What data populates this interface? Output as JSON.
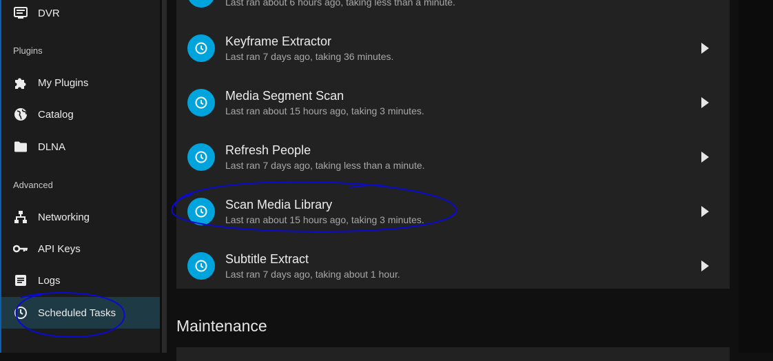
{
  "sidebar": {
    "items_top": [
      {
        "label": "DVR",
        "icon": "tv-icon"
      }
    ],
    "plugins_header": "Plugins",
    "plugins": [
      {
        "label": "My Plugins",
        "icon": "puzzle-icon"
      },
      {
        "label": "Catalog",
        "icon": "globe-icon"
      },
      {
        "label": "DLNA",
        "icon": "folder-icon"
      }
    ],
    "advanced_header": "Advanced",
    "advanced": [
      {
        "label": "Networking",
        "icon": "network-icon"
      },
      {
        "label": "API Keys",
        "icon": "key-icon"
      },
      {
        "label": "Logs",
        "icon": "document-icon"
      },
      {
        "label": "Scheduled Tasks",
        "icon": "clock-icon",
        "active": true
      }
    ]
  },
  "tasks": [
    {
      "name": "",
      "subtitle": "Last ran about 6 hours ago, taking less than a minute."
    },
    {
      "name": "Keyframe Extractor",
      "subtitle": "Last ran 7 days ago, taking 36 minutes."
    },
    {
      "name": "Media Segment Scan",
      "subtitle": "Last ran about 15 hours ago, taking 3 minutes."
    },
    {
      "name": "Refresh People",
      "subtitle": "Last ran 7 days ago, taking less than a minute."
    },
    {
      "name": "Scan Media Library",
      "subtitle": "Last ran about 15 hours ago, taking 3 minutes."
    },
    {
      "name": "Subtitle Extract",
      "subtitle": "Last ran 7 days ago, taking about 1 hour."
    }
  ],
  "maintenance_title": "Maintenance",
  "colors": {
    "accent": "#00a4dc",
    "active_bg": "#1d3a45",
    "annotation": "#0a0ad0"
  }
}
